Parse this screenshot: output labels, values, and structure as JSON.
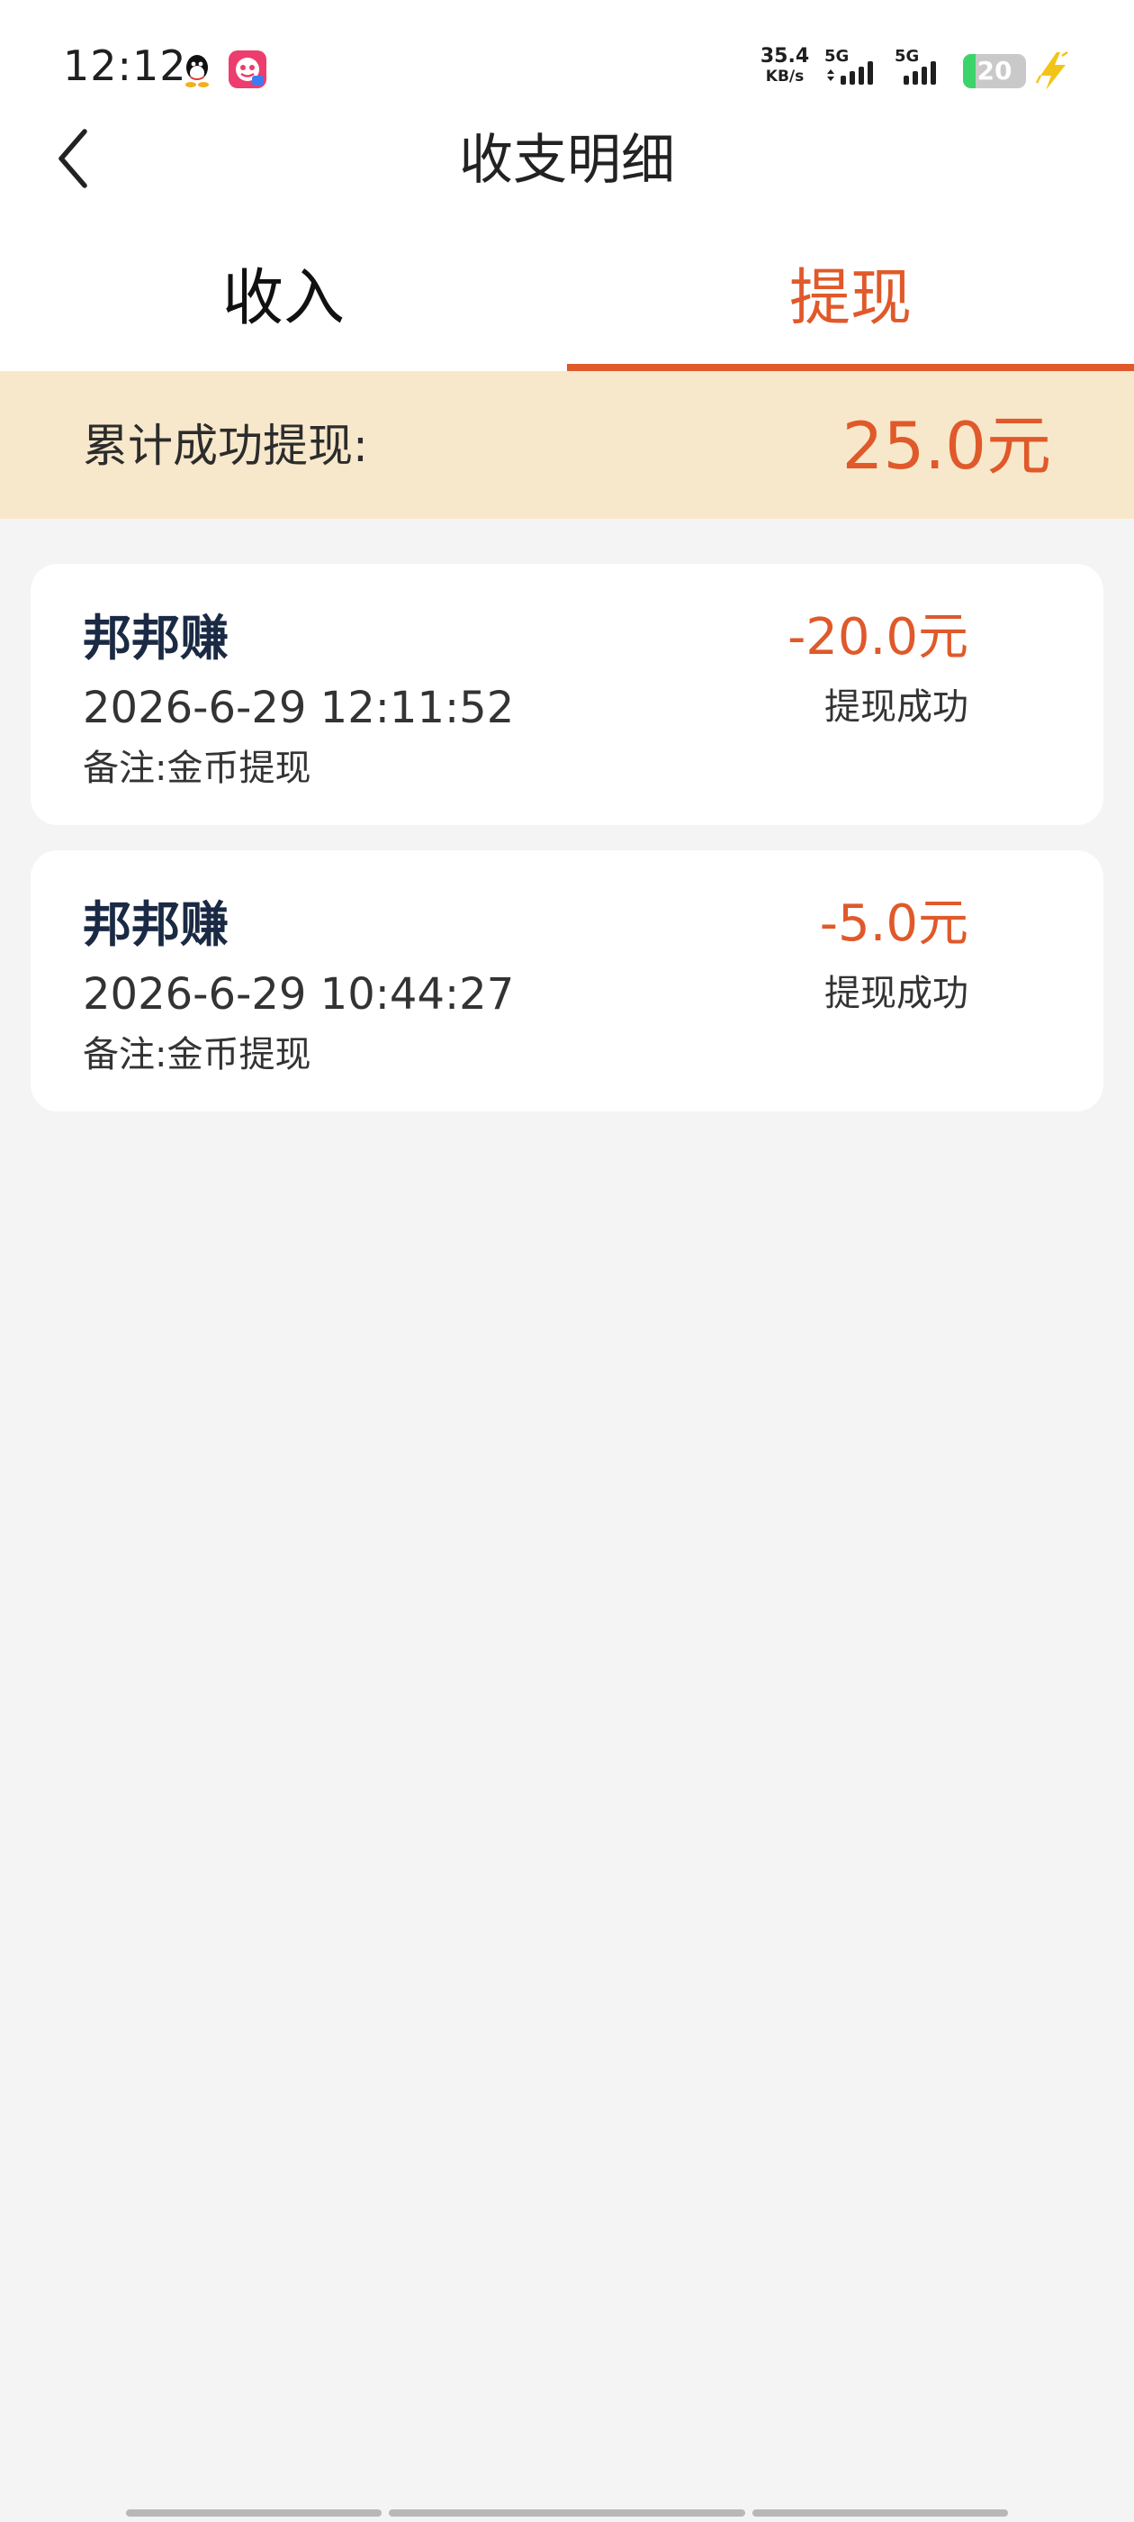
{
  "status_bar": {
    "time": "12:12",
    "net_speed_value": "35.4",
    "net_speed_unit": "KB/s",
    "sim1_label": "5G",
    "sim2_label": "5G",
    "battery_level": "20",
    "battery_percent": 20,
    "charging": true
  },
  "header": {
    "title": "收支明细",
    "back_icon": "chevron-left-icon"
  },
  "tabs": [
    {
      "label": "收入",
      "active": false
    },
    {
      "label": "提现",
      "active": true
    }
  ],
  "summary": {
    "label": "累计成功提现:",
    "amount": "25.0元"
  },
  "records": [
    {
      "name": "邦邦赚",
      "time": "2026-6-29 12:11:52",
      "note": "备注:金币提现",
      "amount": "-20.0元",
      "status": "提现成功"
    },
    {
      "name": "邦邦赚",
      "time": "2026-6-29 10:44:27",
      "note": "备注:金币提现",
      "amount": "-5.0元",
      "status": "提现成功"
    }
  ],
  "colors": {
    "accent": "#e0592a",
    "summary_bg": "#f7e8cb",
    "page_bg": "#f4f4f4",
    "name_text": "#1b2a44",
    "battery_fill": "#3bd46b",
    "bolt": "#f2c418"
  }
}
